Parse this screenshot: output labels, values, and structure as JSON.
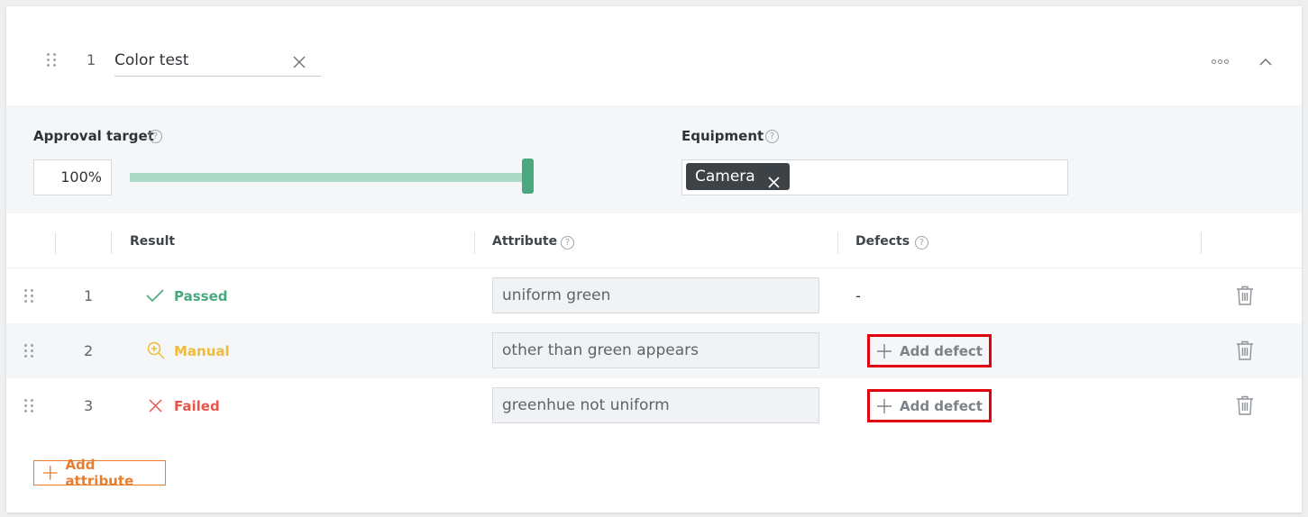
{
  "header": {
    "index": "1",
    "title": "Color test"
  },
  "settings": {
    "approval_label": "Approval target",
    "approval_value": "100%",
    "approval_fraction": 1.0,
    "equipment_label": "Equipment",
    "equipment_chips": [
      "Camera"
    ],
    "help_glyph": "?"
  },
  "table": {
    "columns": [
      "Result",
      "Attribute",
      "Defects"
    ],
    "rows": [
      {
        "num": "1",
        "status": "Passed",
        "status_color": "#4aa87e",
        "status_icon": "check-icon",
        "attribute": "uniform green",
        "defect": "-"
      },
      {
        "num": "2",
        "status": "Manual",
        "status_color": "#f0bb3b",
        "status_icon": "zoom-in-icon",
        "attribute": "other than green appears",
        "defect": "Add defect"
      },
      {
        "num": "3",
        "status": "Failed",
        "status_color": "#e8554a",
        "status_icon": "x-icon",
        "attribute": "greenhue not uniform",
        "defect": "Add defect"
      }
    ]
  },
  "footer": {
    "add_attribute_label": "Add attribute"
  },
  "colors": {
    "accent_green": "#4aa87e",
    "accent_orange": "#ec7c2d",
    "highlight_red": "#e3000f"
  }
}
